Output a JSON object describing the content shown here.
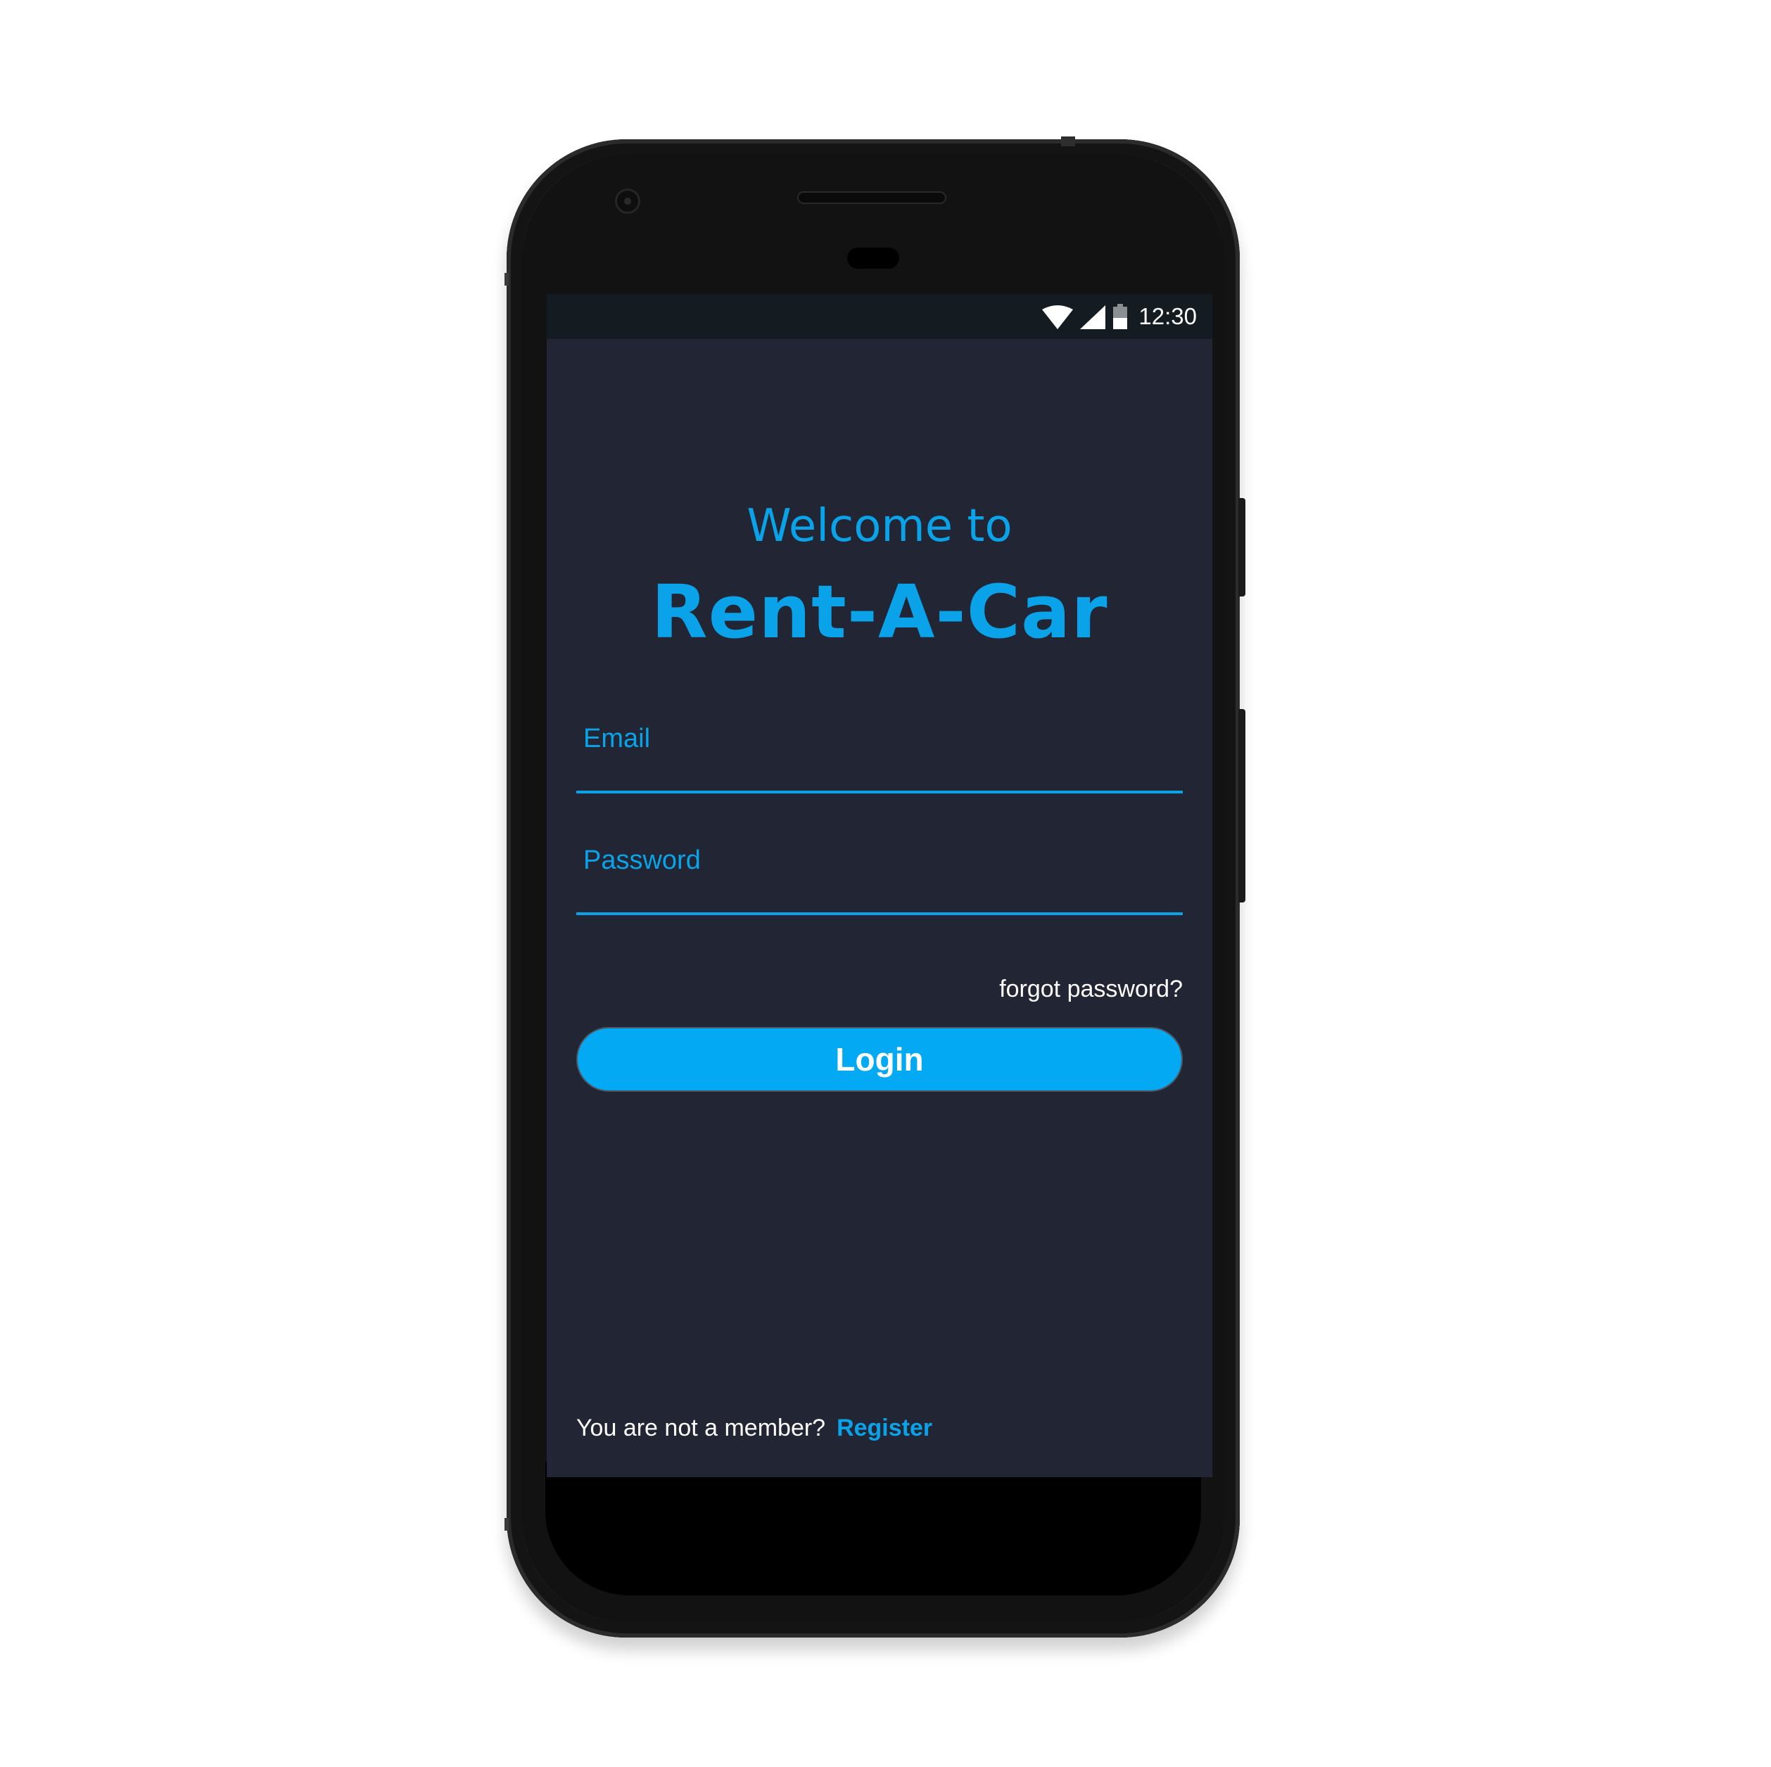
{
  "statusbar": {
    "time": "12:30",
    "icons": [
      "wifi-icon",
      "signal-icon",
      "battery-icon"
    ]
  },
  "header": {
    "welcome": "Welcome to",
    "app_name": "Rent-A-Car"
  },
  "form": {
    "email_label": "Email",
    "email_value": "",
    "password_label": "Password",
    "password_value": "",
    "forgot_label": "forgot password?",
    "login_label": "Login"
  },
  "footer": {
    "prompt": "You are not a member?",
    "register_label": "Register"
  },
  "colors": {
    "accent": "#0aa2e8",
    "button": "#04a9f4",
    "background": "#222533",
    "statusbar": "#141c22"
  }
}
